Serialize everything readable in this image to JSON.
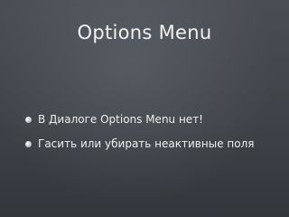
{
  "slide": {
    "title": "Options Menu",
    "bullets": [
      {
        "text": "В Диалоге Options Menu нет!"
      },
      {
        "text": "Гасить или убирать неактивные поля"
      }
    ]
  }
}
